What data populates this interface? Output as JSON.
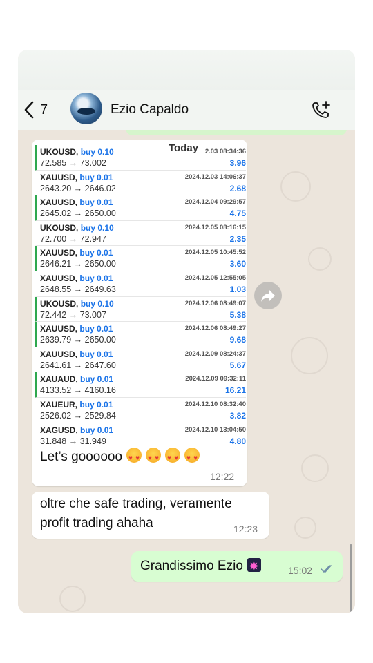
{
  "header": {
    "back_count": "7",
    "contact_name": "Ezio Capaldo"
  },
  "chat": {
    "day_label": "Today",
    "trades": [
      {
        "symbol": "UKOUSD,",
        "action": "buy 0.10",
        "datetime": "2024.12.03 08:34:36",
        "prices": "72.585 → 73.002",
        "profit": "3.96",
        "marked": true
      },
      {
        "symbol": "XAUUSD,",
        "action": "buy 0.01",
        "datetime": "2024.12.03 14:06:37",
        "prices": "2643.20 → 2646.02",
        "profit": "2.68",
        "marked": false
      },
      {
        "symbol": "XAUUSD,",
        "action": "buy 0.01",
        "datetime": "2024.12.04 09:29:57",
        "prices": "2645.02 → 2650.00",
        "profit": "4.75",
        "marked": true
      },
      {
        "symbol": "UKOUSD,",
        "action": "buy 0.10",
        "datetime": "2024.12.05 08:16:15",
        "prices": "72.700 → 72.947",
        "profit": "2.35",
        "marked": false
      },
      {
        "symbol": "XAUUSD,",
        "action": "buy 0.01",
        "datetime": "2024.12.05 10:45:52",
        "prices": "2646.21 → 2650.00",
        "profit": "3.60",
        "marked": true
      },
      {
        "symbol": "XAUUSD,",
        "action": "buy 0.01",
        "datetime": "2024.12.05 12:55:05",
        "prices": "2648.55 → 2649.63",
        "profit": "1.03",
        "marked": false
      },
      {
        "symbol": "UKOUSD,",
        "action": "buy 0.10",
        "datetime": "2024.12.06 08:49:07",
        "prices": "72.442 → 73.007",
        "profit": "5.38",
        "marked": true
      },
      {
        "symbol": "XAUUSD,",
        "action": "buy 0.01",
        "datetime": "2024.12.06 08:49:27",
        "prices": "2639.79 → 2650.00",
        "profit": "9.68",
        "marked": true
      },
      {
        "symbol": "XAUUSD,",
        "action": "buy 0.01",
        "datetime": "2024.12.09 08:24:37",
        "prices": "2641.61 → 2647.60",
        "profit": "5.67",
        "marked": false
      },
      {
        "symbol": "XAUAUD,",
        "action": "buy 0.01",
        "datetime": "2024.12.09 09:32:11",
        "prices": "4133.52 → 4160.16",
        "profit": "16.21",
        "marked": true
      },
      {
        "symbol": "XAUEUR,",
        "action": "buy 0.01",
        "datetime": "2024.12.10 08:32:40",
        "prices": "2526.02 → 2529.84",
        "profit": "3.82",
        "marked": false
      },
      {
        "symbol": "XAGUSD,",
        "action": "buy 0.01",
        "datetime": "2024.12.10 13:04:50",
        "prices": "31.848 → 31.949",
        "profit": "4.80",
        "marked": false
      }
    ],
    "msg1": {
      "text": "Let’s goooooo",
      "time": "12:22",
      "emoji": "smiling-face-with-heart-eyes"
    },
    "msg2": {
      "line1": "oltre che safe trading, veramente",
      "line2": "profit trading ahaha",
      "time": "12:23"
    },
    "msg3": {
      "text": "Grandissimo Ezio",
      "time": "15:02",
      "emoji": "sparkler",
      "status": "read"
    }
  },
  "colors": {
    "header_bg": "#f2f5f2",
    "chat_bg": "#ece5dc",
    "outgoing_bubble": "#d8fdd2",
    "incoming_bubble": "#ffffff",
    "buy_blue": "#1a73e8",
    "marker_green": "#2fa84f"
  }
}
